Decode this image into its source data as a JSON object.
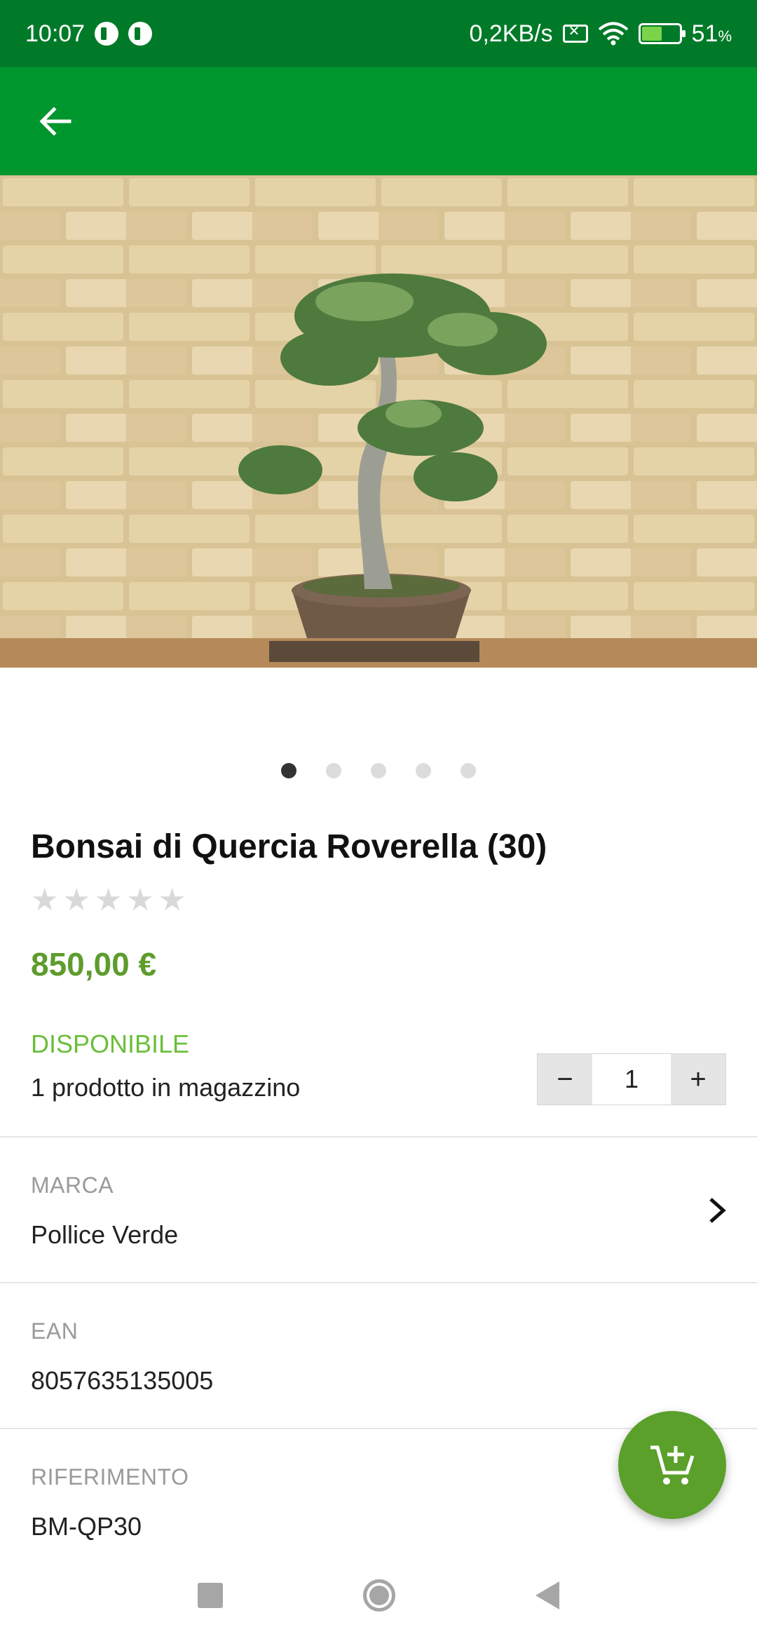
{
  "status_bar": {
    "time": "10:07",
    "speed": "0,2KB/s",
    "battery": "51",
    "battery_unit": "%",
    "icons": [
      "app-notification-icon",
      "app-notification-icon",
      "sim-off-icon",
      "wifi-icon",
      "battery-charging-icon"
    ]
  },
  "app_bar": {
    "back_icon": "arrow-left-icon",
    "color": "#00962e"
  },
  "gallery": {
    "image": "bonsai-oak-photo",
    "page_count": 5,
    "active_page": 1
  },
  "product": {
    "title": "Bonsai di Quercia Roverella (30)",
    "rating": 0,
    "rating_max": 5,
    "price": "850,00 €",
    "availability": "DISPONIBILE",
    "stock_text": "1 prodotto in magazzino",
    "quantity": "1",
    "qty_minus": "−",
    "qty_plus": "+"
  },
  "details": {
    "brand_label": "MARCA",
    "brand_value": "Pollice Verde",
    "ean_label": "EAN",
    "ean_value": "8057635135005",
    "ref_label": "RIFERIMENTO",
    "ref_value": "BM-QP30"
  },
  "fab": {
    "icon": "add-to-cart-icon",
    "color": "#5aa02a"
  },
  "colors": {
    "status_bar": "#007a28",
    "price": "#5e9c2d",
    "available": "#6abf3a"
  },
  "nav_bar": {
    "icons": [
      "recents-square-icon",
      "home-circle-icon",
      "back-triangle-icon"
    ]
  }
}
